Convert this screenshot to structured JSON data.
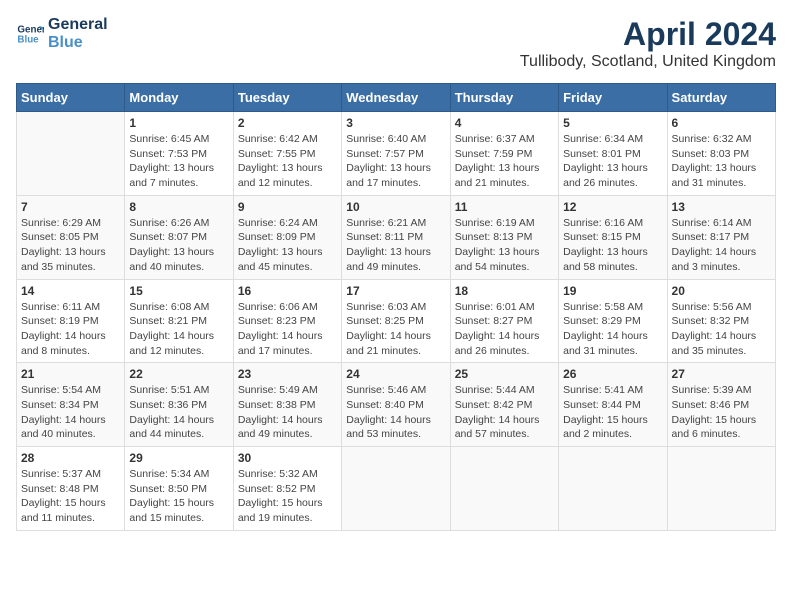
{
  "header": {
    "logo_line1": "General",
    "logo_line2": "Blue",
    "title": "April 2024",
    "subtitle": "Tullibody, Scotland, United Kingdom"
  },
  "days_of_week": [
    "Sunday",
    "Monday",
    "Tuesday",
    "Wednesday",
    "Thursday",
    "Friday",
    "Saturday"
  ],
  "weeks": [
    [
      {
        "day": "",
        "info": ""
      },
      {
        "day": "1",
        "info": "Sunrise: 6:45 AM\nSunset: 7:53 PM\nDaylight: 13 hours\nand 7 minutes."
      },
      {
        "day": "2",
        "info": "Sunrise: 6:42 AM\nSunset: 7:55 PM\nDaylight: 13 hours\nand 12 minutes."
      },
      {
        "day": "3",
        "info": "Sunrise: 6:40 AM\nSunset: 7:57 PM\nDaylight: 13 hours\nand 17 minutes."
      },
      {
        "day": "4",
        "info": "Sunrise: 6:37 AM\nSunset: 7:59 PM\nDaylight: 13 hours\nand 21 minutes."
      },
      {
        "day": "5",
        "info": "Sunrise: 6:34 AM\nSunset: 8:01 PM\nDaylight: 13 hours\nand 26 minutes."
      },
      {
        "day": "6",
        "info": "Sunrise: 6:32 AM\nSunset: 8:03 PM\nDaylight: 13 hours\nand 31 minutes."
      }
    ],
    [
      {
        "day": "7",
        "info": "Sunrise: 6:29 AM\nSunset: 8:05 PM\nDaylight: 13 hours\nand 35 minutes."
      },
      {
        "day": "8",
        "info": "Sunrise: 6:26 AM\nSunset: 8:07 PM\nDaylight: 13 hours\nand 40 minutes."
      },
      {
        "day": "9",
        "info": "Sunrise: 6:24 AM\nSunset: 8:09 PM\nDaylight: 13 hours\nand 45 minutes."
      },
      {
        "day": "10",
        "info": "Sunrise: 6:21 AM\nSunset: 8:11 PM\nDaylight: 13 hours\nand 49 minutes."
      },
      {
        "day": "11",
        "info": "Sunrise: 6:19 AM\nSunset: 8:13 PM\nDaylight: 13 hours\nand 54 minutes."
      },
      {
        "day": "12",
        "info": "Sunrise: 6:16 AM\nSunset: 8:15 PM\nDaylight: 13 hours\nand 58 minutes."
      },
      {
        "day": "13",
        "info": "Sunrise: 6:14 AM\nSunset: 8:17 PM\nDaylight: 14 hours\nand 3 minutes."
      }
    ],
    [
      {
        "day": "14",
        "info": "Sunrise: 6:11 AM\nSunset: 8:19 PM\nDaylight: 14 hours\nand 8 minutes."
      },
      {
        "day": "15",
        "info": "Sunrise: 6:08 AM\nSunset: 8:21 PM\nDaylight: 14 hours\nand 12 minutes."
      },
      {
        "day": "16",
        "info": "Sunrise: 6:06 AM\nSunset: 8:23 PM\nDaylight: 14 hours\nand 17 minutes."
      },
      {
        "day": "17",
        "info": "Sunrise: 6:03 AM\nSunset: 8:25 PM\nDaylight: 14 hours\nand 21 minutes."
      },
      {
        "day": "18",
        "info": "Sunrise: 6:01 AM\nSunset: 8:27 PM\nDaylight: 14 hours\nand 26 minutes."
      },
      {
        "day": "19",
        "info": "Sunrise: 5:58 AM\nSunset: 8:29 PM\nDaylight: 14 hours\nand 31 minutes."
      },
      {
        "day": "20",
        "info": "Sunrise: 5:56 AM\nSunset: 8:32 PM\nDaylight: 14 hours\nand 35 minutes."
      }
    ],
    [
      {
        "day": "21",
        "info": "Sunrise: 5:54 AM\nSunset: 8:34 PM\nDaylight: 14 hours\nand 40 minutes."
      },
      {
        "day": "22",
        "info": "Sunrise: 5:51 AM\nSunset: 8:36 PM\nDaylight: 14 hours\nand 44 minutes."
      },
      {
        "day": "23",
        "info": "Sunrise: 5:49 AM\nSunset: 8:38 PM\nDaylight: 14 hours\nand 49 minutes."
      },
      {
        "day": "24",
        "info": "Sunrise: 5:46 AM\nSunset: 8:40 PM\nDaylight: 14 hours\nand 53 minutes."
      },
      {
        "day": "25",
        "info": "Sunrise: 5:44 AM\nSunset: 8:42 PM\nDaylight: 14 hours\nand 57 minutes."
      },
      {
        "day": "26",
        "info": "Sunrise: 5:41 AM\nSunset: 8:44 PM\nDaylight: 15 hours\nand 2 minutes."
      },
      {
        "day": "27",
        "info": "Sunrise: 5:39 AM\nSunset: 8:46 PM\nDaylight: 15 hours\nand 6 minutes."
      }
    ],
    [
      {
        "day": "28",
        "info": "Sunrise: 5:37 AM\nSunset: 8:48 PM\nDaylight: 15 hours\nand 11 minutes."
      },
      {
        "day": "29",
        "info": "Sunrise: 5:34 AM\nSunset: 8:50 PM\nDaylight: 15 hours\nand 15 minutes."
      },
      {
        "day": "30",
        "info": "Sunrise: 5:32 AM\nSunset: 8:52 PM\nDaylight: 15 hours\nand 19 minutes."
      },
      {
        "day": "",
        "info": ""
      },
      {
        "day": "",
        "info": ""
      },
      {
        "day": "",
        "info": ""
      },
      {
        "day": "",
        "info": ""
      }
    ]
  ]
}
